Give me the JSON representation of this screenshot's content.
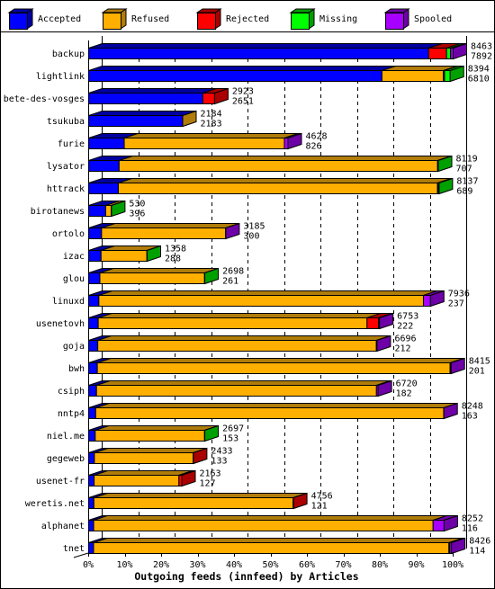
{
  "legend": [
    {
      "label": "Accepted",
      "color": "#0000FF",
      "shade": "#0000A0"
    },
    {
      "label": "Refused",
      "color": "#FFAF00",
      "shade": "#B07C0A"
    },
    {
      "label": "Rejected",
      "color": "#FF0000",
      "shade": "#AA0000"
    },
    {
      "label": "Missing",
      "color": "#00FF00",
      "shade": "#00A000"
    },
    {
      "label": "Spooled",
      "color": "#A800FF",
      "shade": "#6E00A8"
    }
  ],
  "chart_data": {
    "type": "bar",
    "orientation": "horizontal",
    "stacked": true,
    "title": "Outgoing feeds (innfeed) by Articles",
    "xlabel": "Outgoing feeds (innfeed) by Articles",
    "ylabel": "",
    "xlim": [
      0,
      100
    ],
    "x_unit": "percent of largest feed total",
    "xticks": [
      "0%",
      "10%",
      "20%",
      "30%",
      "40%",
      "50%",
      "60%",
      "70%",
      "80%",
      "90%",
      "100%"
    ],
    "grid": true,
    "legend_position": "top",
    "categories": [
      "backup",
      "lightlink",
      "bete-des-vosges",
      "tsukuba",
      "furie",
      "lysator",
      "httrack",
      "birotanews",
      "ortolo",
      "izac",
      "glou",
      "linuxd",
      "usenetovh",
      "goja",
      "bwh",
      "csiph",
      "nntp4",
      "niel.me",
      "gegeweb",
      "usenet-fr",
      "weretis.net",
      "alphanet",
      "tnet"
    ],
    "totals": [
      8463,
      8394,
      2923,
      2184,
      4628,
      8119,
      8137,
      530,
      3185,
      1358,
      2698,
      7936,
      6753,
      6696,
      8415,
      6720,
      8248,
      2697,
      2433,
      2163,
      4756,
      8252,
      8426
    ],
    "series": [
      {
        "name": "Accepted",
        "values": [
          7892,
          6810,
          2651,
          2183,
          826,
          707,
          689,
          396,
          300,
          288,
          261,
          237,
          222,
          212,
          201,
          182,
          163,
          153,
          133,
          127,
          121,
          116,
          114
        ]
      },
      {
        "name": "Refused",
        "values": [
          0,
          1427,
          0,
          1,
          3718,
          7395,
          7410,
          130,
          2880,
          1065,
          2430,
          7536,
          6241,
          6468,
          8190,
          6500,
          8080,
          2538,
          2295,
          1969,
          4627,
          7881,
          8251
        ]
      },
      {
        "name": "Rejected",
        "values": [
          418,
          27,
          272,
          0,
          0,
          0,
          20,
          0,
          0,
          0,
          0,
          0,
          266,
          0,
          0,
          0,
          0,
          0,
          5,
          67,
          8,
          0,
          20
        ]
      },
      {
        "name": "Missing",
        "values": [
          96,
          130,
          0,
          0,
          0,
          17,
          18,
          4,
          0,
          5,
          7,
          0,
          0,
          0,
          0,
          0,
          0,
          6,
          0,
          0,
          0,
          0,
          0
        ]
      },
      {
        "name": "Spooled",
        "values": [
          57,
          0,
          0,
          0,
          84,
          0,
          0,
          0,
          5,
          0,
          0,
          163,
          24,
          16,
          24,
          38,
          5,
          0,
          0,
          0,
          0,
          255,
          41
        ]
      }
    ]
  }
}
